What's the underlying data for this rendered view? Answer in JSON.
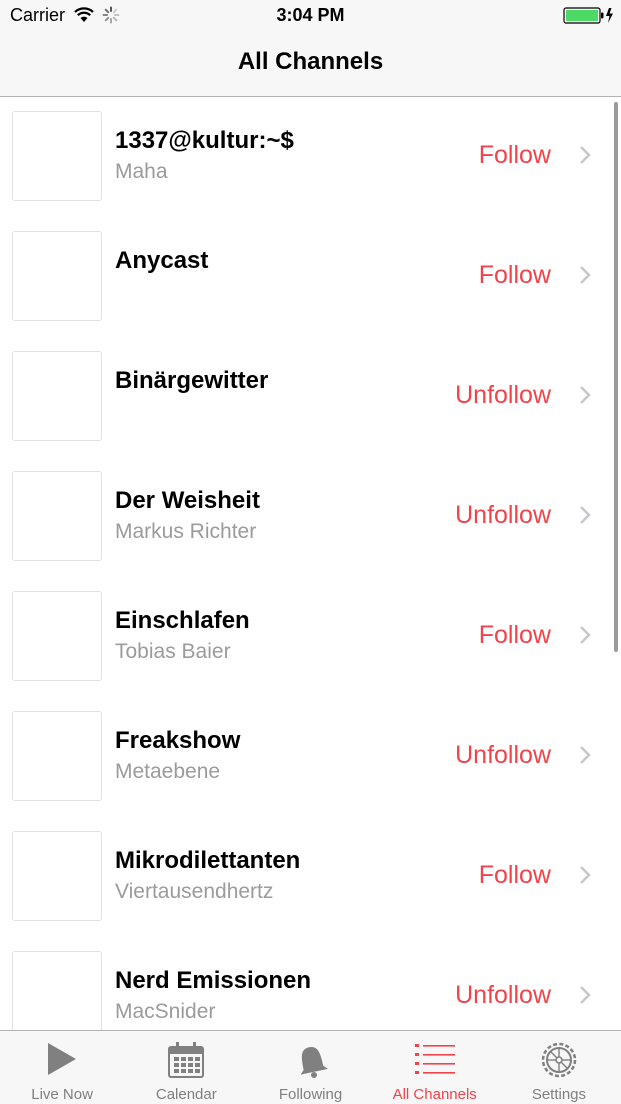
{
  "status_bar": {
    "carrier": "Carrier",
    "time": "3:04 PM",
    "icons": [
      "wifi-icon",
      "activity-spinner-icon",
      "battery-charging-icon"
    ]
  },
  "nav": {
    "title": "All Channels"
  },
  "channels": [
    {
      "title": "1337@kultur:~$",
      "subtitle": "Maha",
      "action": "Follow"
    },
    {
      "title": "Anycast",
      "subtitle": "",
      "action": "Follow"
    },
    {
      "title": "Binärgewitter",
      "subtitle": "",
      "action": "Unfollow"
    },
    {
      "title": "Der Weisheit",
      "subtitle": "Markus Richter",
      "action": "Unfollow"
    },
    {
      "title": "Einschlafen",
      "subtitle": "Tobias Baier",
      "action": "Follow"
    },
    {
      "title": "Freakshow",
      "subtitle": "Metaebene",
      "action": "Unfollow"
    },
    {
      "title": "Mikrodilettanten",
      "subtitle": "Viertausendhertz",
      "action": "Follow"
    },
    {
      "title": "Nerd Emissionen",
      "subtitle": "MacSnider",
      "action": "Unfollow"
    }
  ],
  "tabs": [
    {
      "label": "Live Now",
      "icon": "play-icon",
      "active": false
    },
    {
      "label": "Calendar",
      "icon": "calendar-icon",
      "active": false
    },
    {
      "label": "Following",
      "icon": "bell-icon",
      "active": false
    },
    {
      "label": "All Channels",
      "icon": "list-icon",
      "active": true
    },
    {
      "label": "Settings",
      "icon": "gear-icon",
      "active": false
    }
  ],
  "colors": {
    "accent": "#f0434a",
    "subtitle": "#9b9b9b",
    "tab_inactive": "#7f7f7f",
    "bar_background": "#f7f7f7",
    "battery": "#4cd964"
  }
}
